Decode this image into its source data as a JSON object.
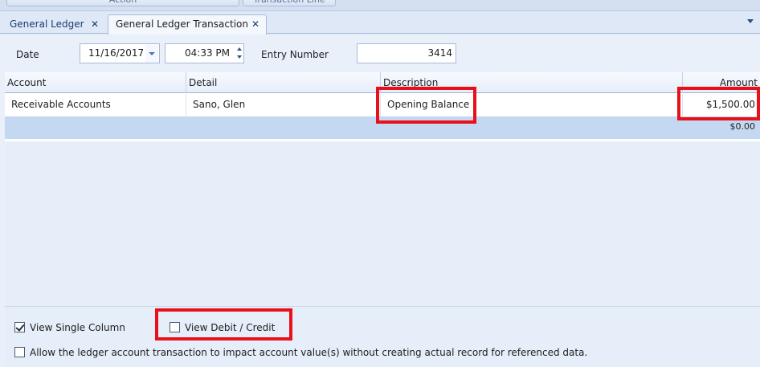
{
  "toolbar": {
    "action_label": "Action",
    "transaction_line_label": "Transaction Line"
  },
  "tabs": [
    {
      "label": "General Ledger",
      "active": false
    },
    {
      "label": "General Ledger Transaction",
      "active": true
    }
  ],
  "form": {
    "date_label": "Date",
    "date_value": "11/16/2017",
    "time_value": "04:33 PM",
    "entry_number_label": "Entry Number",
    "entry_number_value": "3414"
  },
  "grid": {
    "columns": [
      "Account",
      "Detail",
      "Description",
      "Amount"
    ],
    "rows": [
      {
        "account": "Receivable Accounts",
        "detail": "Sano, Glen",
        "description": "Opening Balance",
        "amount": "$1,500.00"
      }
    ],
    "footer_total": "$0.00"
  },
  "options": {
    "view_single_column": {
      "label": "View Single Column",
      "checked": true
    },
    "view_debit_credit": {
      "label": "View Debit / Credit",
      "checked": false
    },
    "allow_ledger": {
      "label": "Allow the ledger account transaction to impact account value(s) without creating actual record for referenced data.",
      "checked": false
    }
  },
  "colors": {
    "highlight": "#e8101a",
    "accent": "#1b3d73"
  }
}
